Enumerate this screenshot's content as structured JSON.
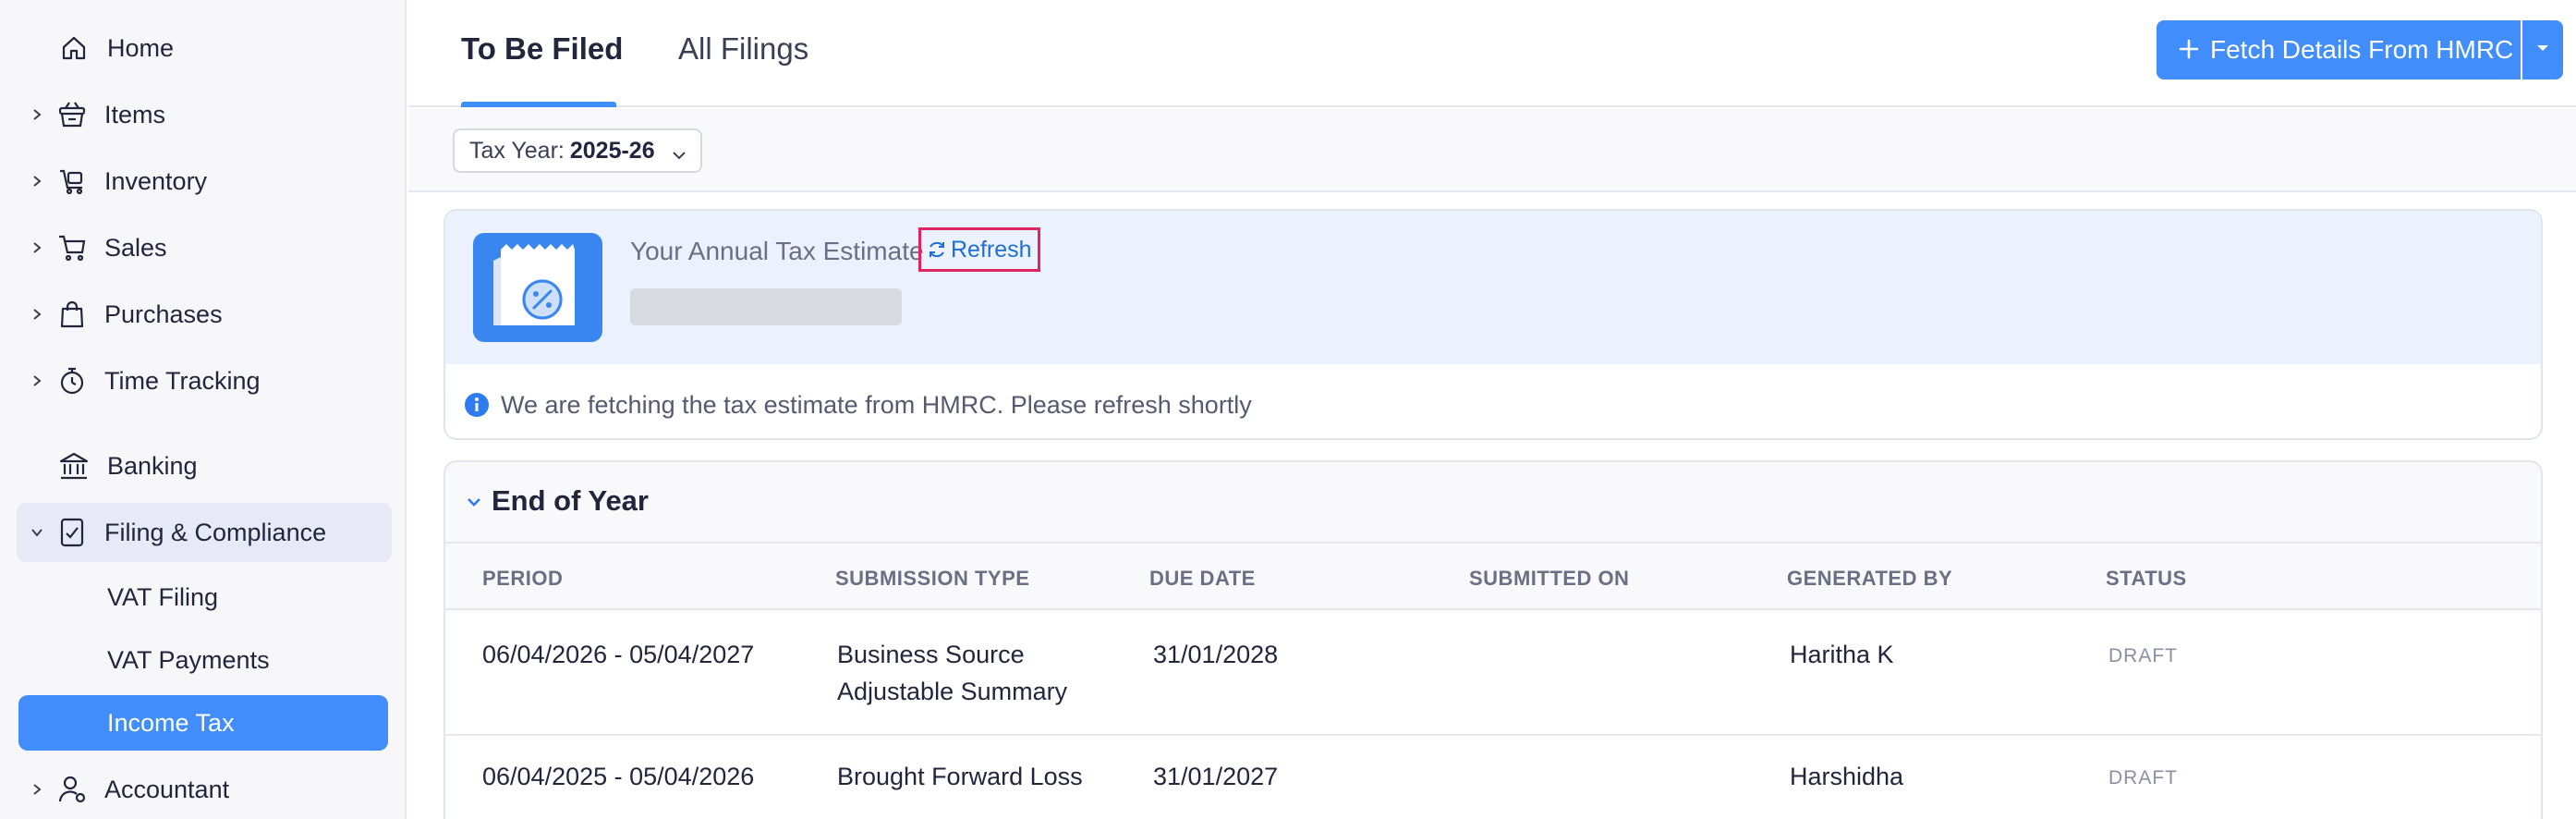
{
  "sidebar": {
    "items": [
      {
        "label": "Home",
        "icon": "home-icon"
      },
      {
        "label": "Items",
        "icon": "basket-icon"
      },
      {
        "label": "Inventory",
        "icon": "inventory-icon"
      },
      {
        "label": "Sales",
        "icon": "cart-icon"
      },
      {
        "label": "Purchases",
        "icon": "bag-icon"
      },
      {
        "label": "Time Tracking",
        "icon": "stopwatch-icon"
      },
      {
        "label": "Banking",
        "icon": "bank-icon"
      },
      {
        "label": "Filing & Compliance",
        "icon": "filing-icon"
      },
      {
        "label": "Accountant",
        "icon": "accountant-icon"
      }
    ],
    "subitems": [
      {
        "label": "VAT Filing"
      },
      {
        "label": "VAT Payments"
      },
      {
        "label": "Income Tax"
      }
    ]
  },
  "header": {
    "tabs": [
      {
        "label": "To Be Filed"
      },
      {
        "label": "All Filings"
      }
    ],
    "fetch_button": "Fetch Details From HMRC"
  },
  "filter": {
    "label": "Tax Year:",
    "value": "2025-26"
  },
  "estimate": {
    "title": "Your Annual Tax Estimate",
    "refresh": "Refresh",
    "info": "We are fetching the tax estimate from HMRC. Please refresh shortly"
  },
  "end_of_year": {
    "title": "End of Year",
    "columns": [
      "PERIOD",
      "SUBMISSION TYPE",
      "DUE DATE",
      "SUBMITTED ON",
      "GENERATED BY",
      "STATUS"
    ],
    "rows": [
      {
        "period": "06/04/2026 - 05/04/2027",
        "type_line1": "Business Source",
        "type_line2": "Adjustable Summary",
        "due": "31/01/2028",
        "submitted": "",
        "generated_by": "Haritha K",
        "status": "DRAFT"
      },
      {
        "period": "06/04/2025 - 05/04/2026",
        "type_line1": "Brought Forward Loss",
        "type_line2": "",
        "due": "31/01/2027",
        "submitted": "",
        "generated_by": "Harshidha",
        "status": "DRAFT"
      }
    ]
  },
  "colors": {
    "accent": "#408dfb",
    "highlight_border": "#e0245e",
    "card_bg": "#ebf2fe"
  }
}
